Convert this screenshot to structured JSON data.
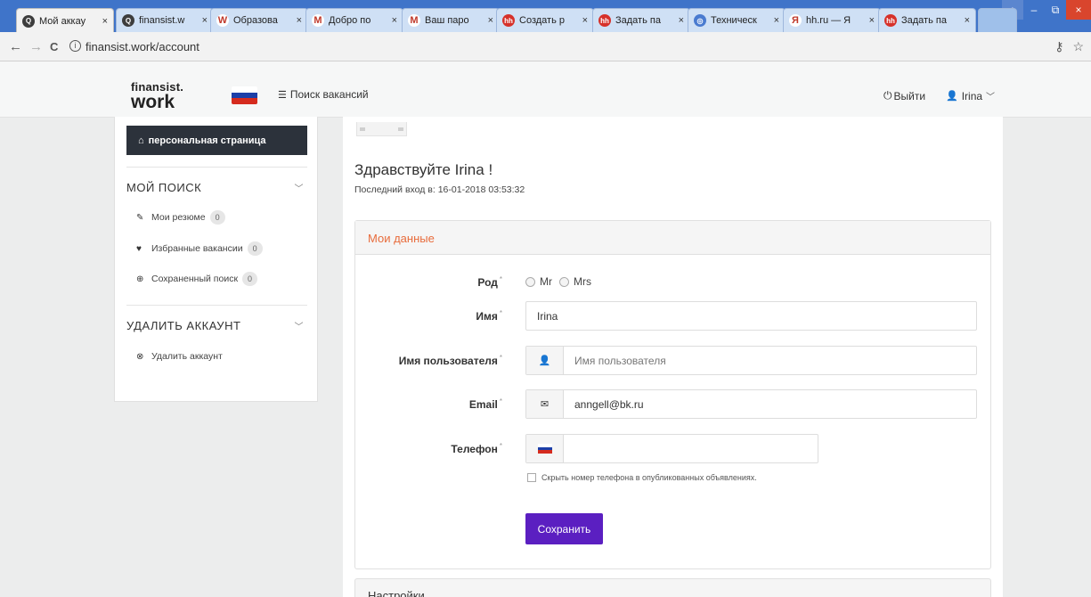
{
  "browser": {
    "tabs": [
      {
        "title": "Мой аккау",
        "favicon_color": "#3d3d3d",
        "favicon_glyph": "Q"
      },
      {
        "title": "finansist.w",
        "favicon_color": "#3d3d3d",
        "favicon_glyph": "Q"
      },
      {
        "title": "Образова",
        "favicon_color": "#ffffff",
        "favicon_glyph": "W"
      },
      {
        "title": "Добро по",
        "favicon_color": "#ffffff",
        "favicon_glyph": "M"
      },
      {
        "title": "Ваш паро",
        "favicon_color": "#ffffff",
        "favicon_glyph": "M"
      },
      {
        "title": "Создать р",
        "favicon_color": "#d6312a",
        "favicon_glyph": "hh"
      },
      {
        "title": "Задать па",
        "favicon_color": "#d6312a",
        "favicon_glyph": "hh"
      },
      {
        "title": "Техничеcк",
        "favicon_color": "#4a7bd0",
        "favicon_glyph": "◎"
      },
      {
        "title": "hh.ru — Я",
        "favicon_color": "#ffffff",
        "favicon_glyph": "Я"
      },
      {
        "title": "Задать па",
        "favicon_color": "#d6312a",
        "favicon_glyph": "hh"
      }
    ],
    "tab_close": "×",
    "url": "finansist.work/account",
    "info_icon": "i",
    "back_icon": "←",
    "forward_icon": "→",
    "reload_icon": "C",
    "key_icon": "⚷",
    "star_icon": "☆",
    "win_user": "▲",
    "win_min": "–",
    "win_max": "⧉",
    "win_close": "×"
  },
  "header": {
    "logo_line1": "finansist.",
    "logo_line2": "work",
    "flag_colors": [
      "#ffffff",
      "#1c3fa8",
      "#d52b1e"
    ],
    "vacancy_icon": "☰",
    "vacancy_search": "Поиск вакансий",
    "logout_icon": "⏻",
    "logout": "Выйти",
    "user_icon": "👤",
    "user_name": "Irina",
    "user_chevron": "﹀"
  },
  "sidebar": {
    "home_icon": "⌂",
    "personal_page": "персональная страница",
    "section1": {
      "title": "МОЙ ПОИСК",
      "chevron": "﹀",
      "items": [
        {
          "icon": "✎",
          "label": "Мои резюме",
          "count": "0"
        },
        {
          "icon": "♥",
          "label": "Избранные вакансии",
          "count": "0"
        },
        {
          "icon": "⊕",
          "label": "Сохраненный поиск",
          "count": "0"
        }
      ]
    },
    "section2": {
      "title": "УДАЛИТЬ АККАУНТ",
      "chevron": "﹀",
      "items": [
        {
          "icon": "⊗",
          "label": "Удалить аккаунт"
        }
      ]
    }
  },
  "main": {
    "greeting": "Здравствуйте Irina !",
    "last_login": "Последний вход в: 16-01-2018 03:53:32",
    "panel_title": "Мои данные",
    "form": {
      "gender_label": "Род",
      "gender_options": [
        "Mr",
        "Mrs"
      ],
      "name_label": "Имя",
      "name_value": "Irina",
      "username_label": "Имя пользователя",
      "username_icon": "👤",
      "username_placeholder": "Имя пользователя",
      "email_label": "Email",
      "email_icon": "✉",
      "email_value": "anngell@bk.ru",
      "phone_label": "Телефон",
      "phone_value": "",
      "hide_phone": "Скрыть номер телефона в опубликованных объявлениях.",
      "required_mark": "*",
      "save_button": "Сохранить"
    },
    "settings_panel": "Настройки"
  }
}
